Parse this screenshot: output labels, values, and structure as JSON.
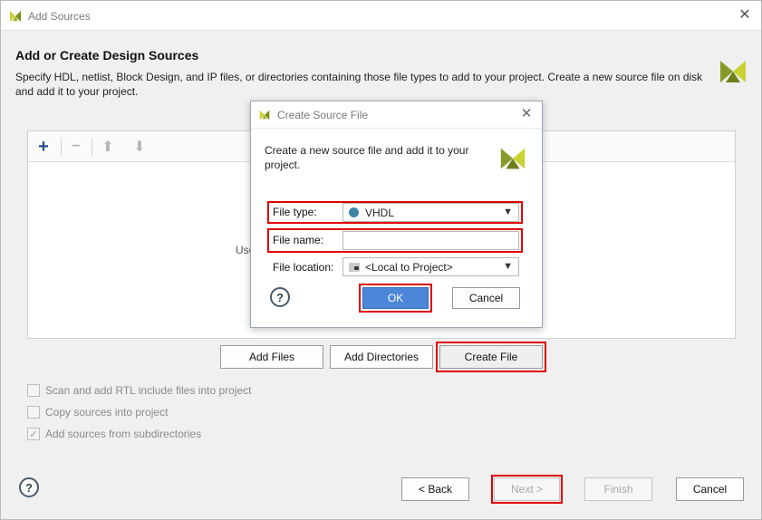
{
  "window": {
    "title": "Add Sources",
    "close_icon": "close-icon"
  },
  "main": {
    "heading": "Add or Create Design Sources",
    "description": "Specify HDL, netlist, Block Design, and IP files, or directories containing those file types to add to your project. Create a new source file on disk and add it to your project.",
    "panel_hint": "Use",
    "toolbar": {
      "add": "+",
      "remove": "−",
      "up": "⬆",
      "down": "⬇"
    },
    "buttons": {
      "add_files": "Add Files",
      "add_directories": "Add Directories",
      "create_file": "Create File"
    },
    "options": [
      {
        "label": "Scan and add RTL include files into project",
        "checked": false
      },
      {
        "label": "Copy sources into project",
        "checked": false
      },
      {
        "label": "Add sources from subdirectories",
        "checked": true
      }
    ]
  },
  "footer": {
    "help": "?",
    "back": "< Back",
    "next": "Next >",
    "finish": "Finish",
    "cancel": "Cancel"
  },
  "dialog": {
    "title": "Create Source File",
    "description": "Create a new source file and add it to your project.",
    "file_type_label": "File type:",
    "file_type_value": "VHDL",
    "file_name_label": "File name:",
    "file_name_value": "",
    "file_location_label": "File location:",
    "file_location_value": "<Local to Project>",
    "help": "?",
    "ok": "OK",
    "cancel": "Cancel"
  },
  "colors": {
    "accent_red": "#e00000",
    "primary_blue": "#4b86d8",
    "vhdl_dot": "#3f86a6",
    "logo_yellow": "#8a9a2a"
  }
}
